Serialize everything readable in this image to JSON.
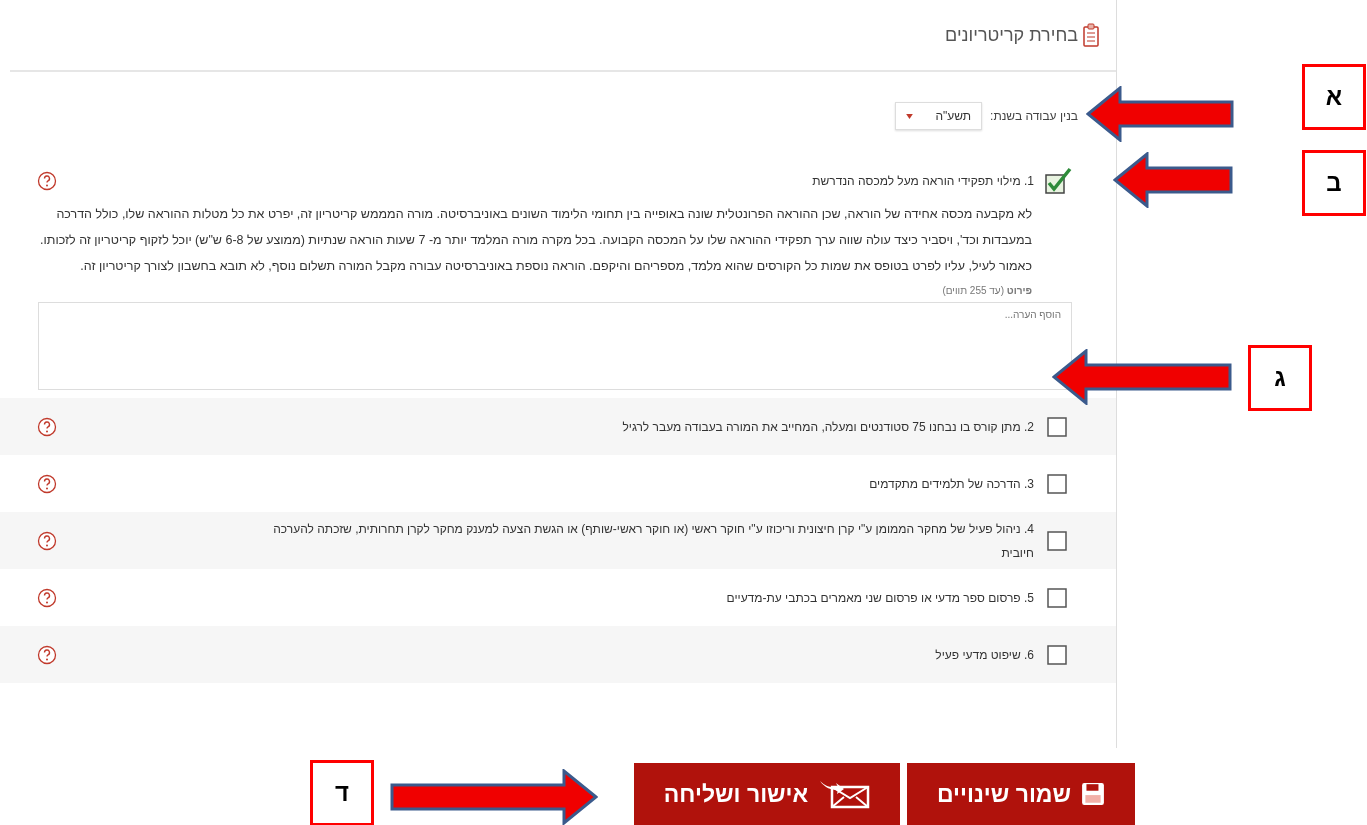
{
  "panel": {
    "title": "בחירת קריטריונים"
  },
  "year_field": {
    "label": "בנין עבודה בשנת:",
    "value": "תשע\"ה"
  },
  "criteria": [
    {
      "label": "1. מילוי תפקידי הוראה מעל למכסה הנדרשת",
      "checked": true,
      "description": "לא מקבעה מכסה אחידה של הוראה, שכן ההוראה הפרונטלית שונה באופייה בין תחומי הלימוד השונים באוניברסיטה. מורה המממש קריטריון זה, יפרט את כל מטלות ההוראה שלו, כולל הדרכה במעבדות וכד', ויסביר כיצד עולה שווה ערך תפקידי ההוראה שלו על המכסה הקבועה. בכל מקרה מורה המלמד יותר מ- 7 שעות הוראה שנתיות (ממוצע של 6-8 ש\"ש) יוכל לזקוף קריטריון זה לזכותו. כאמור לעיל, עליו לפרט בטופס את שמות כל הקורסים שהוא מלמד, מספריהם והיקפם. הוראה נוספת באוניברסיטה עבורה מקבל המורה תשלום נוסף, לא תובא בחשבון לצורך קריטריון זה.",
      "detail_label": "**פירוט** (עד 255 תווים)",
      "detail_placeholder": "הוסף הערה..."
    },
    {
      "label": "2. מתן קורס בו נבחנו 75 סטודנטים ומעלה, המחייב את המורה בעבודה מעבר לרגיל",
      "checked": false
    },
    {
      "label": "3. הדרכה של תלמידים מתקדמים",
      "checked": false
    },
    {
      "label": "4. ניהול פעיל של מחקר הממומן ע\"י קרן חיצונית וריכוזו ע\"י חוקר ראשי (או חוקר ראשי-שותף) או הגשת הצעה למענק מחקר לקרן תחרותית, שזכתה להערכה חיובית",
      "checked": false
    },
    {
      "label": "5. פרסום ספר מדעי או פרסום שני מאמרים בכתבי עת-מדעיים",
      "checked": false
    },
    {
      "label": "6. שיפוט מדעי פעיל",
      "checked": false
    }
  ],
  "buttons": [
    {
      "kind": "save",
      "label": "שמור שינויים"
    },
    {
      "kind": "send",
      "label": "אישור ושליחה"
    }
  ],
  "annotations": [
    {
      "label": "א",
      "kind": "left"
    },
    {
      "label": "ב",
      "kind": "left"
    },
    {
      "label": "ג",
      "kind": "left"
    },
    {
      "label": "ד",
      "kind": "right"
    }
  ]
}
